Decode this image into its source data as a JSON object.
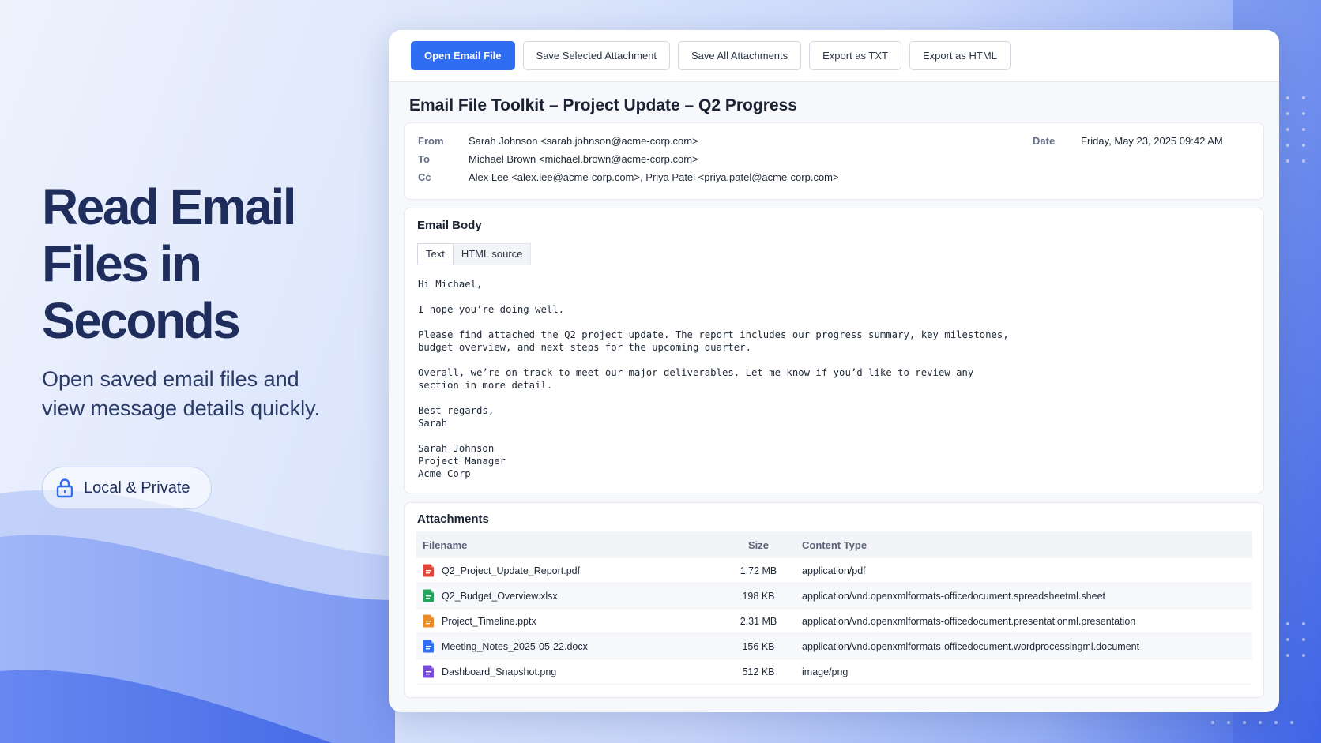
{
  "hero": {
    "title_line1": "Read Email",
    "title_line2": "Files in Seconds",
    "subtitle_line1": "Open saved email files and",
    "subtitle_line2": "view message details quickly.",
    "badge": "Local & Private"
  },
  "toolbar": {
    "open": "Open Email File",
    "save_selected": "Save Selected Attachment",
    "save_all": "Save All Attachments",
    "export_txt": "Export as TXT",
    "export_html": "Export as HTML"
  },
  "subject": "Email File Toolkit – Project Update – Q2 Progress",
  "headers": {
    "from_label": "From",
    "from": "Sarah Johnson <sarah.johnson@acme-corp.com>",
    "to_label": "To",
    "to": "Michael Brown <michael.brown@acme-corp.com>",
    "cc_label": "Cc",
    "cc": "Alex Lee <alex.lee@acme-corp.com>, Priya Patel <priya.patel@acme-corp.com>",
    "date_label": "Date",
    "date": "Friday, May 23, 2025 09:42 AM"
  },
  "body": {
    "title": "Email Body",
    "tab_text": "Text",
    "tab_html": "HTML source",
    "text": "Hi Michael,\n\nI hope you’re doing well.\n\nPlease find attached the Q2 project update. The report includes our progress summary, key milestones,\nbudget overview, and next steps for the upcoming quarter.\n\nOverall, we’re on track to meet our major deliverables. Let me know if you’d like to review any\nsection in more detail.\n\nBest regards,\nSarah\n\nSarah Johnson\nProject Manager\nAcme Corp"
  },
  "attachments": {
    "title": "Attachments",
    "columns": {
      "filename": "Filename",
      "size": "Size",
      "content_type": "Content Type"
    },
    "rows": [
      {
        "name": "Q2_Project_Update_Report.pdf",
        "size": "1.72 MB",
        "type": "application/pdf",
        "icon": "pdf-file-icon",
        "color": "#e0463a"
      },
      {
        "name": "Q2_Budget_Overview.xlsx",
        "size": "198 KB",
        "type": "application/vnd.openxmlformats-officedocument.spreadsheetml.sheet",
        "icon": "spreadsheet-file-icon",
        "color": "#22a45d"
      },
      {
        "name": "Project_Timeline.pptx",
        "size": "2.31 MB",
        "type": "application/vnd.openxmlformats-officedocument.presentationml.presentation",
        "icon": "presentation-file-icon",
        "color": "#f08a24"
      },
      {
        "name": "Meeting_Notes_2025-05-22.docx",
        "size": "156 KB",
        "type": "application/vnd.openxmlformats-officedocument.wordprocessingml.document",
        "icon": "document-file-icon",
        "color": "#2f6df2"
      },
      {
        "name": "Dashboard_Snapshot.png",
        "size": "512 KB",
        "type": "image/png",
        "icon": "image-file-icon",
        "color": "#7a4ad8"
      }
    ]
  },
  "colors": {
    "primary": "#2f6df2",
    "title": "#1e2d5c"
  }
}
